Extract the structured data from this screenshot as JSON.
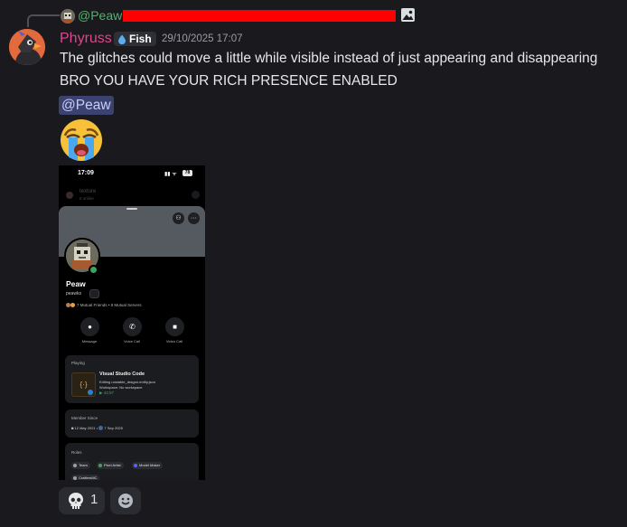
{
  "reply": {
    "author": "@Peaw",
    "redaction_color": "#ff0000",
    "author_color": "#4fb36b",
    "attachment_icon": "image-icon"
  },
  "message": {
    "author": "Phyruss",
    "author_color": "#e0458f",
    "guild_tag": "Fish",
    "guild_tag_icon": "water-drop-icon",
    "timestamp": "29/10/2025 17:07",
    "lines": [
      "The glitches could move a little while visible instead of just appearing and disappearing",
      "BRO YOU HAVE YOUR RICH PRESENCE ENABLED"
    ],
    "mention": "@Peaw",
    "emoji": "loudly-crying-face"
  },
  "attachment": {
    "status_time": "17:09",
    "battery": "78",
    "blurred_channel": "texture",
    "blurred_sub": "6 online",
    "profile": {
      "display_name": "Peaw",
      "username": "peawks",
      "mutual_friends": "7 Mutual Friends",
      "mutual_servers": "8 Mutual Servers",
      "actions": [
        "Message",
        "Voice Call",
        "Video Call"
      ],
      "playing": {
        "label": "Playing",
        "app": "Visual Studio Code",
        "detail1": "Editing unstable_dragon.entity.json",
        "detail2": "Workspace: No workspace",
        "elapsed": "44:57"
      },
      "member_since": {
        "label": "Member Since",
        "discord": "12 May 2021",
        "server": "7 Sep 2025"
      },
      "roles": {
        "label": "Roles",
        "items": [
          {
            "name": "Team",
            "color": "#9aa0a6"
          },
          {
            "name": "Pixel Artist",
            "color": "#3ba55d"
          },
          {
            "name": "Model Maker",
            "color": "#5865f2"
          },
          {
            "name": "CraftersMC",
            "color": "#9aa0a6"
          }
        ]
      }
    }
  },
  "reactions": [
    {
      "emoji": "skull-icon",
      "count": "1"
    },
    {
      "emoji": "add-reaction-icon",
      "count": ""
    }
  ]
}
